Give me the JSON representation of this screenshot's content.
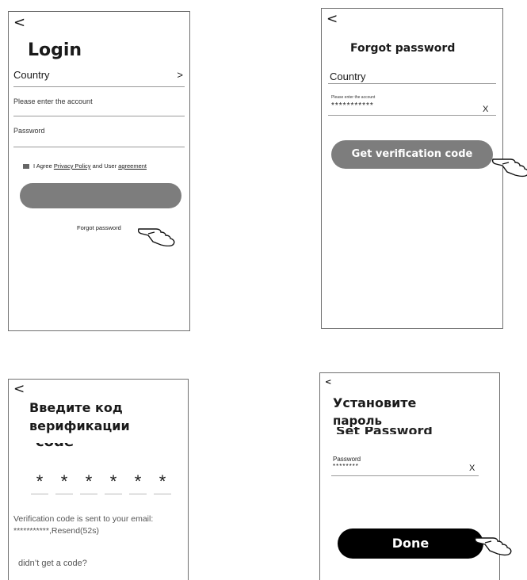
{
  "login": {
    "back": "<",
    "title": "Login",
    "country_label": "Country",
    "country_arrow": ">",
    "account_placeholder": "Please enter the account",
    "password_placeholder": "Password",
    "agree_prefix": "I Agree ",
    "privacy_link": "Privacy Policy",
    "agree_middle": " and User ",
    "agreement_link": "agreement",
    "forgot_link": "Forgot password"
  },
  "forgot": {
    "back": "<",
    "title": "Forgot password",
    "country_label": "Country",
    "account_label": "Please enter the account",
    "account_value": "***********",
    "clear": "X",
    "button_label": "Get verification code"
  },
  "verify": {
    "back": "<",
    "title_line1": "Введите код",
    "title_line2": "верификации",
    "title_ghost": "code",
    "digits": [
      "*",
      "*",
      "*",
      "*",
      "*",
      "*"
    ],
    "info_line1": "Verification code is sent to your email:",
    "info_line2": "***********,Resend(52s)",
    "no_code": "didn’t get a code?"
  },
  "setpw": {
    "back": "<",
    "title_line1": "Установите",
    "title_line2": "пароль",
    "title_ghost": "Set Password",
    "password_label": "Password",
    "password_value": "********",
    "clear": "X",
    "done_label": "Done"
  },
  "colors": {
    "button_gray": "#7d7d7d",
    "button_black": "#000000",
    "frame": "#6f6f6f"
  }
}
